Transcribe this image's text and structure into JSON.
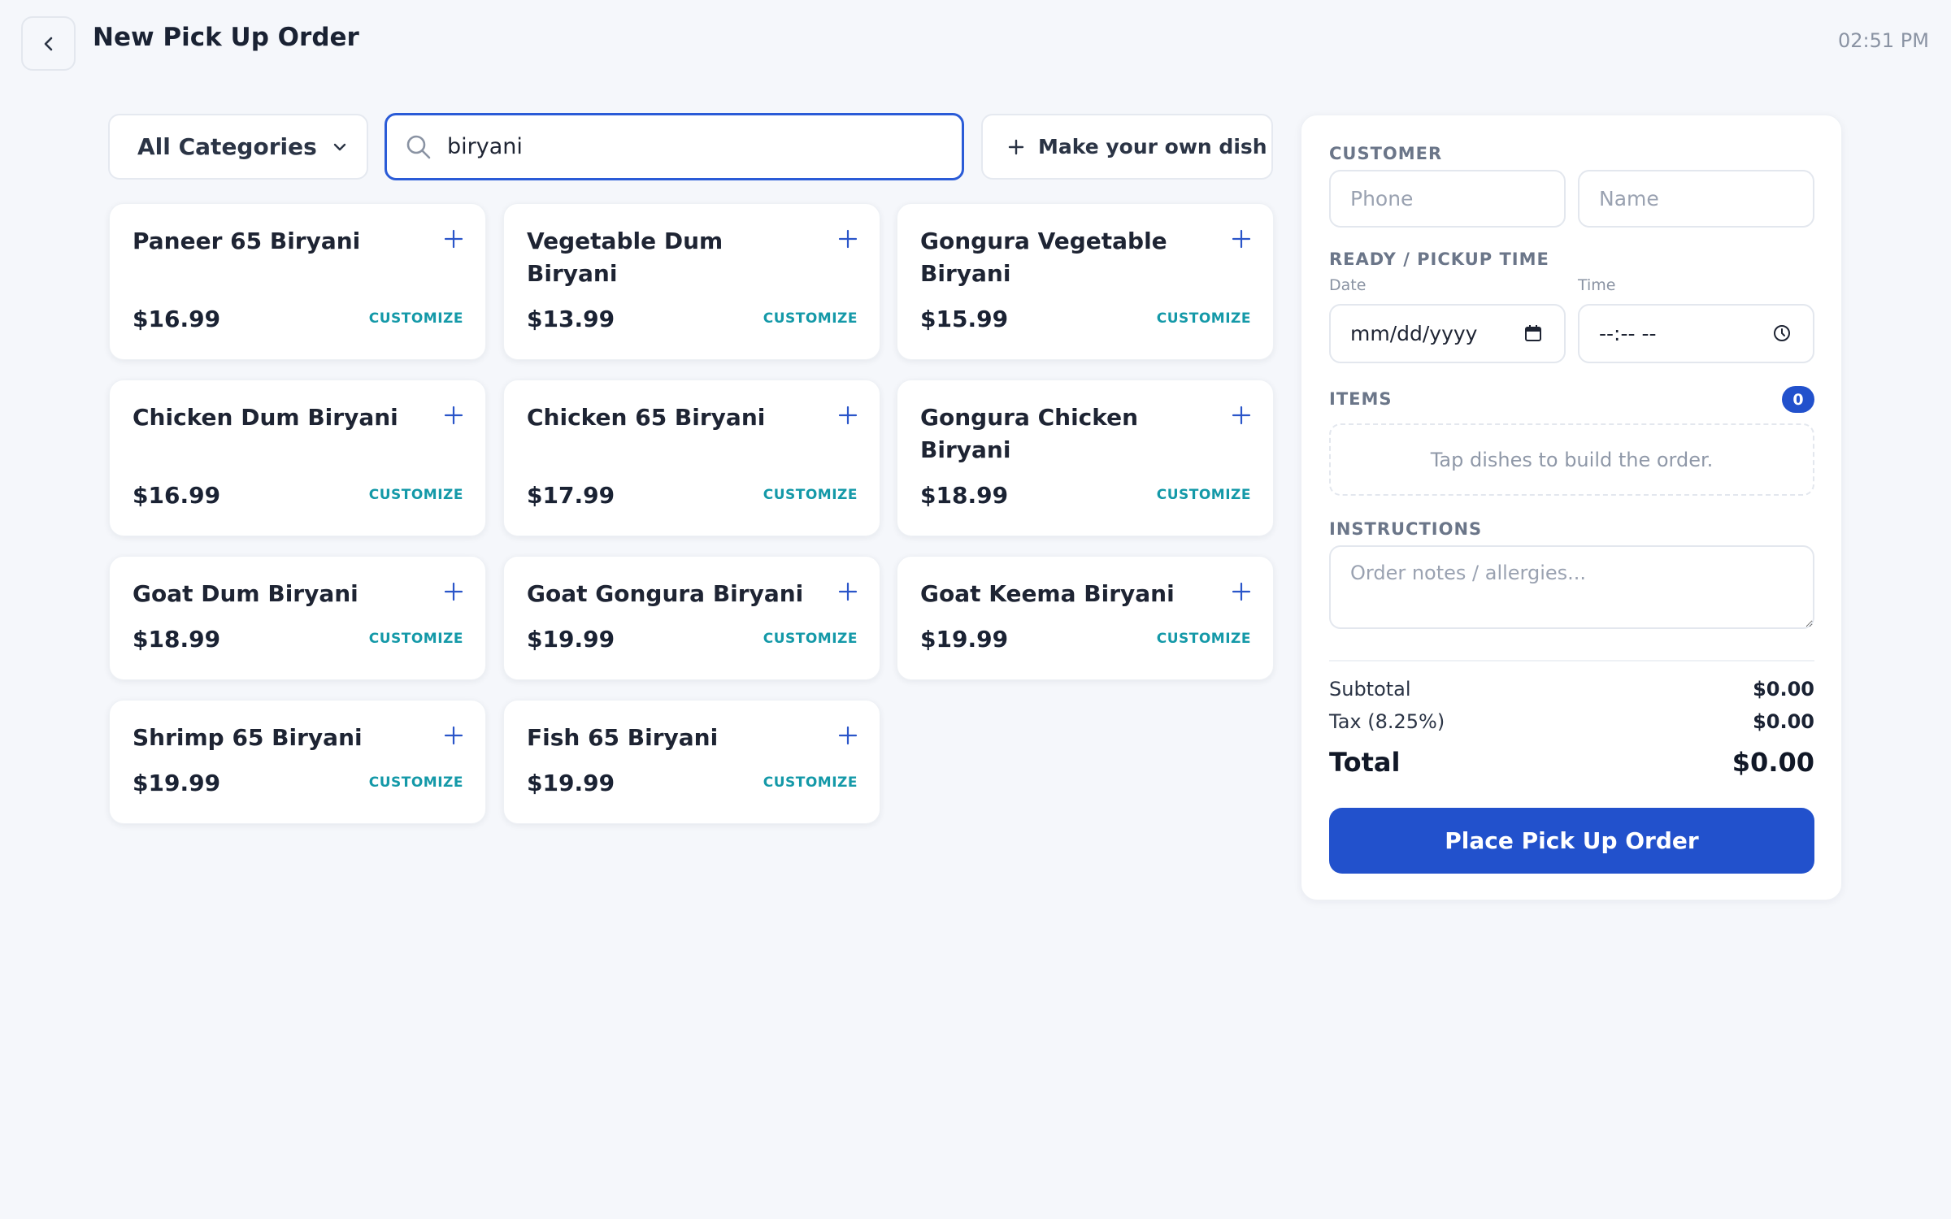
{
  "header": {
    "title": "New Pick Up Order",
    "time": "02:51 PM",
    "back_icon": "chevron-left-icon"
  },
  "toolbar": {
    "category_label": "All Categories",
    "search_value": "biryani",
    "make_own_label": "Make your own dish"
  },
  "dishes": [
    {
      "name": "Paneer 65 Biryani",
      "price": "$16.99",
      "action": "CUSTOMIZE"
    },
    {
      "name": "Vegetable Dum Biryani",
      "price": "$13.99",
      "action": "CUSTOMIZE"
    },
    {
      "name": "Gongura Vegetable Biryani",
      "price": "$15.99",
      "action": "CUSTOMIZE"
    },
    {
      "name": "Chicken Dum Biryani",
      "price": "$16.99",
      "action": "CUSTOMIZE"
    },
    {
      "name": "Chicken 65 Biryani",
      "price": "$17.99",
      "action": "CUSTOMIZE"
    },
    {
      "name": "Gongura Chicken Biryani",
      "price": "$18.99",
      "action": "CUSTOMIZE"
    },
    {
      "name": "Goat Dum Biryani",
      "price": "$18.99",
      "action": "CUSTOMIZE"
    },
    {
      "name": "Goat Gongura Biryani",
      "price": "$19.99",
      "action": "CUSTOMIZE"
    },
    {
      "name": "Goat Keema Biryani",
      "price": "$19.99",
      "action": "CUSTOMIZE"
    },
    {
      "name": "Shrimp 65 Biryani",
      "price": "$19.99",
      "action": "CUSTOMIZE"
    },
    {
      "name": "Fish 65 Biryani",
      "price": "$19.99",
      "action": "CUSTOMIZE"
    }
  ],
  "order": {
    "customer_label": "CUSTOMER",
    "phone_placeholder": "Phone",
    "name_placeholder": "Name",
    "pickup_label": "READY / PICKUP TIME",
    "date_label": "Date",
    "date_placeholder": "mm/dd/yyyy",
    "time_label": "Time",
    "time_placeholder": "--:-- --",
    "items_label": "ITEMS",
    "items_count": "0",
    "items_empty": "Tap dishes to build the order.",
    "instructions_label": "INSTRUCTIONS",
    "instructions_placeholder": "Order notes / allergies...",
    "subtotal_label": "Subtotal",
    "subtotal_value": "$0.00",
    "tax_label": "Tax (8.25%)",
    "tax_value": "$0.00",
    "total_label": "Total",
    "total_value": "$0.00",
    "submit_label": "Place Pick Up Order"
  },
  "colors": {
    "accent": "#2251cc",
    "customize": "#1499a8",
    "background": "#f5f7fb"
  }
}
